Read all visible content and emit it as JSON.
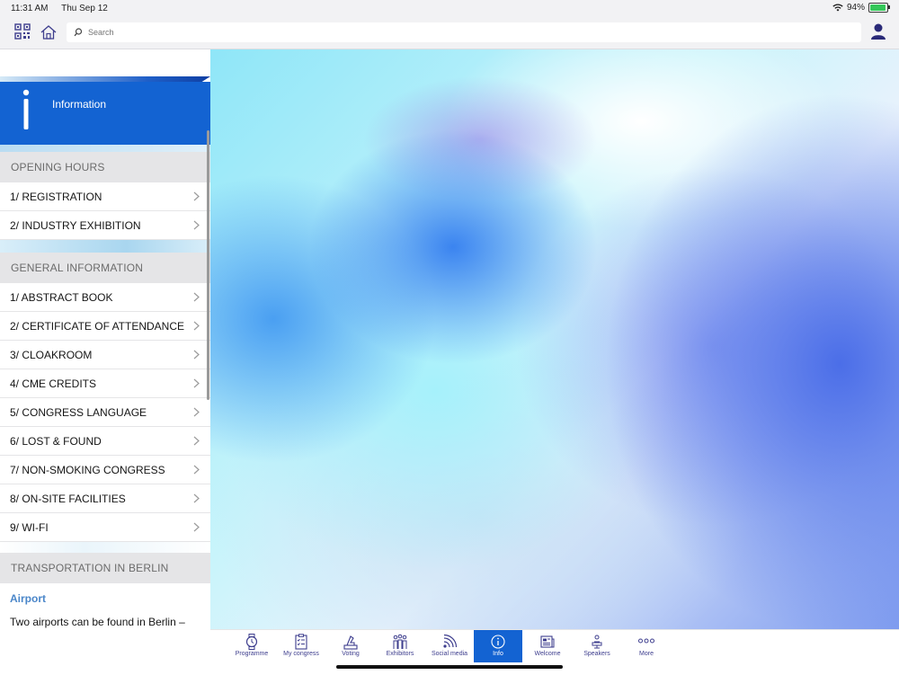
{
  "status": {
    "time": "11:31 AM",
    "date": "Thu Sep 12",
    "battery": "94%",
    "battery_level": 0.94
  },
  "search": {
    "placeholder": "Search"
  },
  "info": {
    "title": "Information"
  },
  "sections": {
    "opening": {
      "title": "OPENING HOURS",
      "items": [
        "1/ REGISTRATION",
        "2/ INDUSTRY EXHIBITION"
      ]
    },
    "general": {
      "title": "GENERAL INFORMATION",
      "items": [
        "1/ ABSTRACT BOOK",
        "2/ CERTIFICATE OF ATTENDANCE",
        "3/ CLOAKROOM",
        "4/ CME CREDITS",
        "5/ CONGRESS LANGUAGE",
        "6/ LOST & FOUND",
        "7/ NON-SMOKING CONGRESS",
        "8/ ON-SITE FACILITIES",
        "9/ WI-FI"
      ]
    },
    "transport": {
      "title": "TRANSPORTATION IN BERLIN",
      "subhead": "Airport",
      "text": "Two airports can be found in Berlin –"
    }
  },
  "tabs": [
    "Programme",
    "My congress",
    "Voting",
    "Exhibitors",
    "Social media",
    "Info",
    "Welcome",
    "Speakers",
    "More"
  ],
  "colors": {
    "accent": "#1363d2",
    "tab_icon": "#3e3e8e"
  }
}
